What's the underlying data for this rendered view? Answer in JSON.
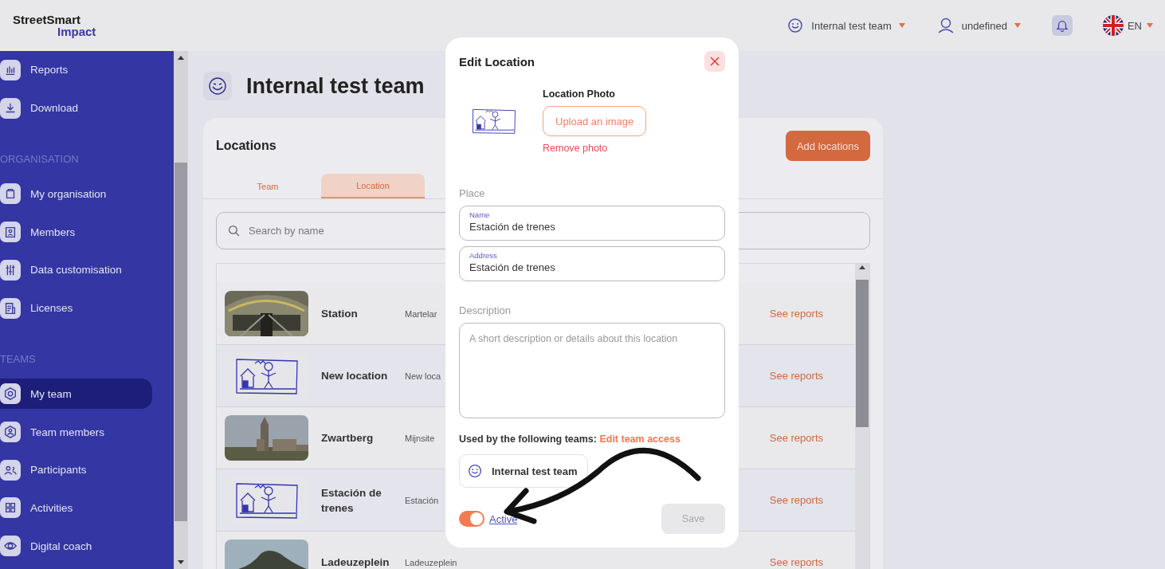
{
  "header": {
    "logo_top": "StreetSmart",
    "logo_bottom": "Impact",
    "team_menu": "Internal test team",
    "user_menu": "undefined",
    "language": "EN"
  },
  "sidebar": {
    "groups": [
      {
        "items": [
          {
            "label": "Reports",
            "selected": false
          },
          {
            "label": "Download",
            "selected": false
          }
        ]
      },
      {
        "heading": "ORGANISATION",
        "items": [
          {
            "label": "My organisation",
            "selected": false
          },
          {
            "label": "Members",
            "selected": false
          },
          {
            "label": "Data customisation",
            "selected": false
          },
          {
            "label": "Licenses",
            "selected": false
          }
        ]
      },
      {
        "heading": "TEAMS",
        "items": [
          {
            "label": "My team",
            "selected": true
          },
          {
            "label": "Team members",
            "selected": false
          },
          {
            "label": "Participants",
            "selected": false
          },
          {
            "label": "Activities",
            "selected": false
          },
          {
            "label": "Digital coach",
            "selected": false
          }
        ]
      }
    ]
  },
  "page": {
    "title": "Internal test team",
    "card_title": "Locations",
    "add_button": "Add locations",
    "tabs": [
      {
        "label": "Team",
        "selected": false
      },
      {
        "label": "Location",
        "selected": true
      }
    ],
    "search": {
      "placeholder": "Search by name"
    },
    "rows": [
      {
        "kind": "picture",
        "name": "Station",
        "address": "Martelar",
        "action": "See reports"
      },
      {
        "kind": "drawing",
        "name": "New location",
        "address": "New loca",
        "action": "See reports"
      },
      {
        "kind": "picture",
        "name": "Zwartberg",
        "address": "Mijnsite",
        "action": "See reports"
      },
      {
        "kind": "drawing",
        "name": "Estación de trenes",
        "address": "Estación",
        "action": "See reports"
      },
      {
        "kind": "picture",
        "name": "Ladeuzeplein",
        "address": "Ladeuzeplein",
        "action": "See reports"
      }
    ]
  },
  "modal": {
    "title": "Edit Location",
    "photo_label": "Location Photo",
    "upload_button": "Upload an image",
    "remove_link": "Remove photo",
    "place_heading": "Place",
    "fields": [
      {
        "label": "Name",
        "value": "Estación de trenes"
      },
      {
        "label": "Address",
        "value": "Estación de trenes"
      }
    ],
    "description_heading": "Description",
    "description": {
      "placeholder": "A short description or details about this location"
    },
    "teams_label": "Used by the following teams:",
    "teams_link": "Edit team access",
    "teams": [
      "Internal test team"
    ],
    "active": {
      "label": "Active",
      "on": true
    },
    "save_button": {
      "label": "Save",
      "disabled": true
    }
  }
}
